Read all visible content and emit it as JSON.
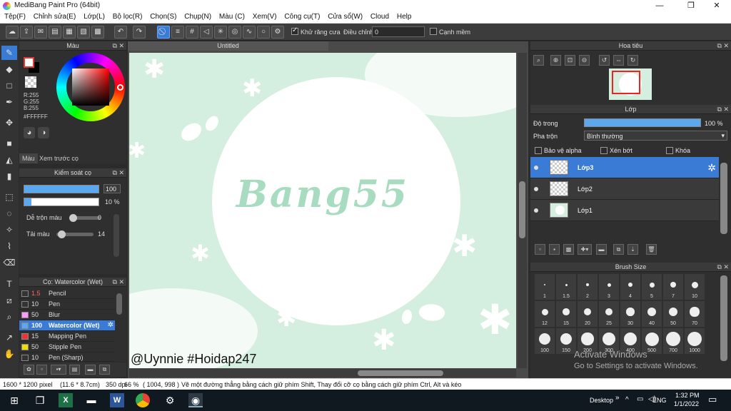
{
  "window": {
    "title": "MediBang Paint Pro (64bit)",
    "minimize": "—",
    "maximize": "❐",
    "close": "✕"
  },
  "menu": [
    "Tệp(F)",
    "Chỉnh sửa(E)",
    "Lớp(L)",
    "Bộ lọc(R)",
    "Chọn(S)",
    "Chụp(N)",
    "Màu (C)",
    "Xem(V)",
    "Công cụ(T)",
    "Cửa sổ(W)",
    "Cloud",
    "Help"
  ],
  "toolbar": {
    "antialias_label": "Khử răng cưa",
    "adjust_label": "Điều chỉnh",
    "adjust_value": "0",
    "snap_label": "Cạnh mềm"
  },
  "color_panel": {
    "title": "Màu",
    "r": "R:255",
    "g": "G:255",
    "b": "B:255",
    "hex": "#FFFFFF",
    "tab_color": "Màu",
    "tab_preview": "Xem trước cọ",
    "fg": "#ffffff"
  },
  "brush_control": {
    "title": "Kiểm soát cọ",
    "size_value": "100",
    "opacity_value": "10 %",
    "size_fill": 1.0,
    "opacity_fill": 0.1,
    "mix_label": "Dễ trộn màu",
    "mix_value": "0",
    "reload_label": "Tải màu",
    "reload_value": "14"
  },
  "brush_list": {
    "title": "Cọ: Watercolor (Wet)",
    "items": [
      {
        "size": "1.5",
        "name": "Pencil",
        "color": "#333333"
      },
      {
        "size": "10",
        "name": "Pen",
        "color": "#333333"
      },
      {
        "size": "50",
        "name": "Blur",
        "color": "#ff99ff"
      },
      {
        "size": "100",
        "name": "Watercolor (Wet)",
        "color": "#5aa9f0"
      },
      {
        "size": "15",
        "name": "Mapping Pen",
        "color": "#ee3333"
      },
      {
        "size": "50",
        "name": "Stipple Pen",
        "color": "#eedd00"
      },
      {
        "size": "10",
        "name": "Pen (Sharp)",
        "color": "#333333"
      }
    ]
  },
  "document": {
    "tab": "Untitled",
    "art_text": "Bang55",
    "watermark": "@Uynnie #Hoidap247"
  },
  "navigator": {
    "title": "Hoa tiêu"
  },
  "layers": {
    "title": "Lớp",
    "opacity_label": "Độ trong",
    "opacity_value": "100 %",
    "opacity_fill": 1.0,
    "blend_label": "Pha trộn",
    "blend_value": "Bình thường",
    "protect_alpha": "Bảo vệ alpha",
    "clip": "Xén bớt",
    "lock": "Khóa",
    "items": [
      {
        "name": "Lớp3",
        "selected": true
      },
      {
        "name": "Lớp2",
        "selected": false
      },
      {
        "name": "Lớp1",
        "selected": false
      }
    ]
  },
  "brush_size": {
    "title": "Brush Size",
    "sizes": [
      "1",
      "1.5",
      "2",
      "3",
      "4",
      "5",
      "7",
      "10",
      "12",
      "15",
      "20",
      "25",
      "30",
      "40",
      "50",
      "70",
      "100",
      "150",
      "200",
      "300",
      "400",
      "500",
      "700",
      "1000"
    ]
  },
  "activate": {
    "line1": "Activate Windows",
    "line2": "Go to Settings to activate Windows."
  },
  "status": {
    "dims": "1600 * 1200 pixel",
    "physical": "(11.6 * 8.7cm)",
    "dpi": "350 dpi",
    "zoom": "66 %",
    "coords": "( 1004, 998 )",
    "hint": "Vẽ một đường thẳng bằng cách giữ phím Shift, Thay đổi cỡ cọ bằng cách giữ phím Ctrl, Alt và kéo"
  },
  "taskbar": {
    "desktop": "Desktop",
    "lang": "ENG",
    "time": "1:32 PM",
    "date": "1/1/2022"
  }
}
